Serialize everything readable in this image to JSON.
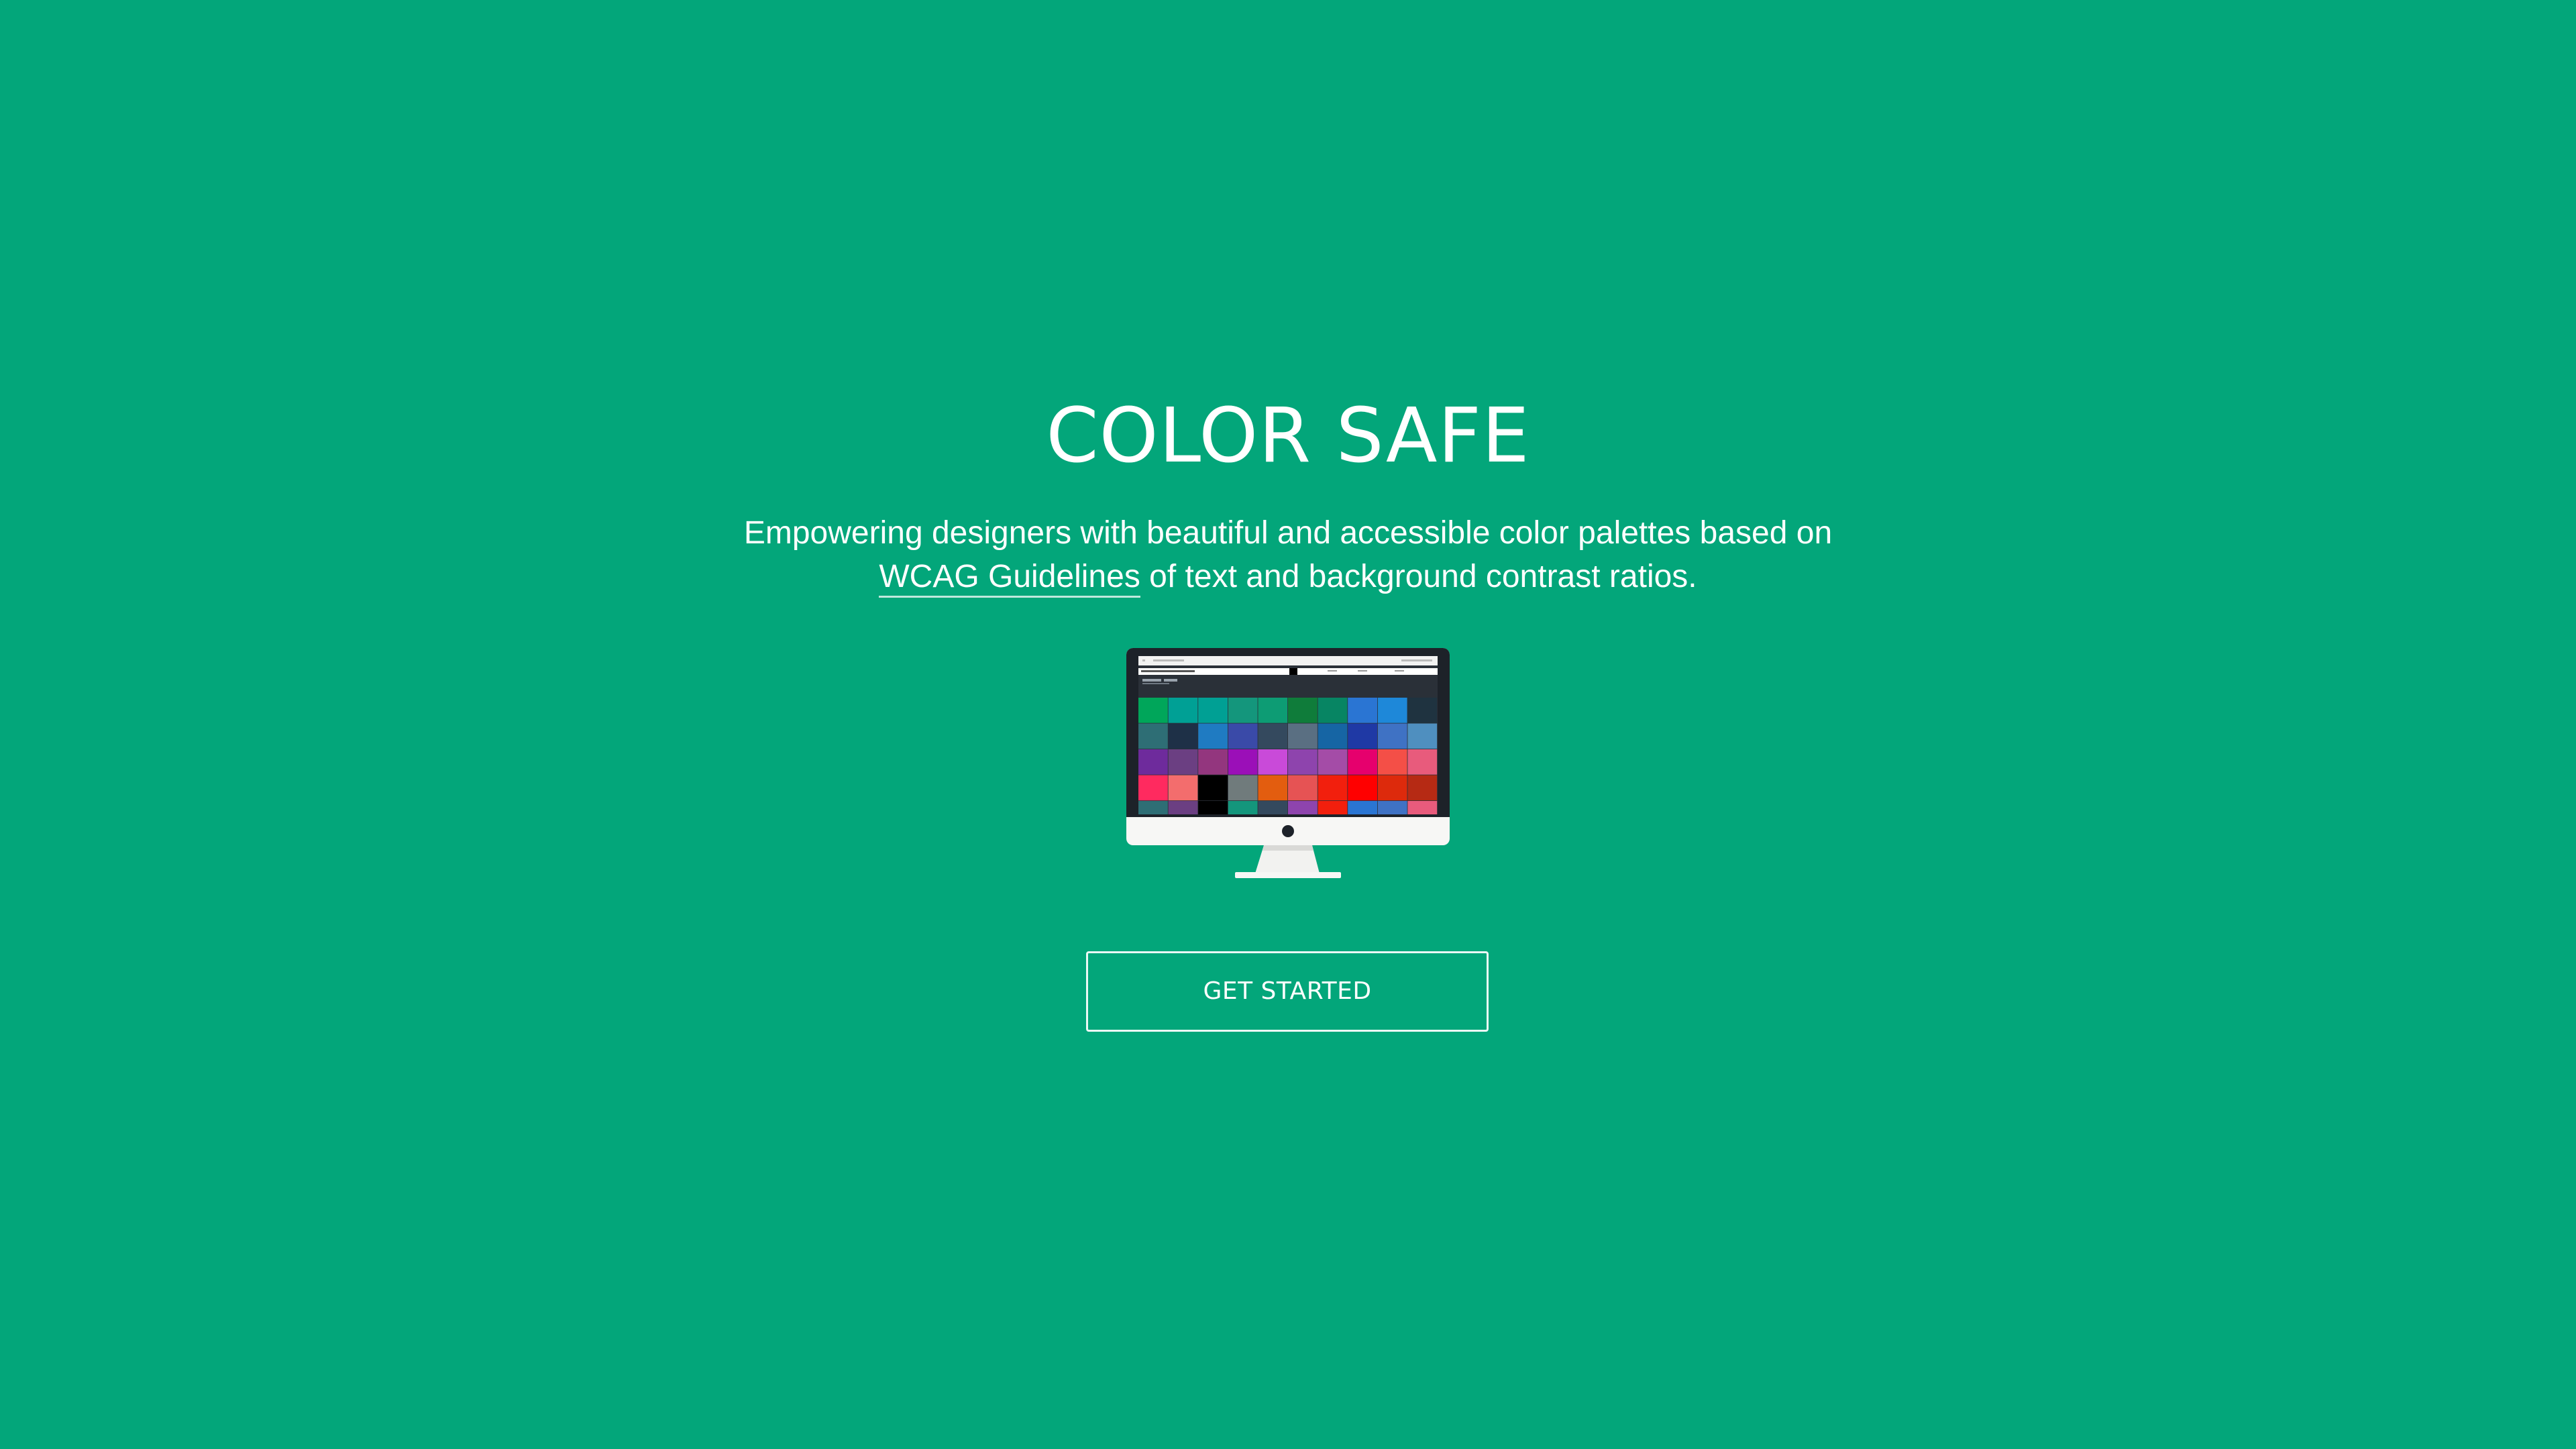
{
  "hero": {
    "title": "COLOR SAFE",
    "subtitle_line1": "Empowering designers with beautiful and accessible color palettes based on",
    "subtitle_link": "WCAG Guidelines",
    "subtitle_line2_rest": " of text and background contrast ratios.",
    "cta_label": "GET STARTED"
  },
  "colors": {
    "background": "#03a67a",
    "text": "#ffffff",
    "monitor_bezel": "#1d2229",
    "monitor_body": "#f7f7f5"
  },
  "monitor_icon": "imac-monitor-icon",
  "palette_swatches": [
    [
      "#00a65a",
      "#00a095",
      "#00a094",
      "#14967c",
      "#0d9c74",
      "#0f7c3a",
      "#078563",
      "#2a75d3",
      "#1e88d9",
      "#1f3340"
    ],
    [
      "#2e6e75",
      "#1e3047",
      "#1f7bc2",
      "#3a4aa8",
      "#34495e",
      "#5a6f82",
      "#1665a4",
      "#1f39a5",
      "#3f72c4",
      "#4f8fbf"
    ],
    [
      "#6e2b9c",
      "#6b3f82",
      "#93367e",
      "#9b0fb8",
      "#c94ad9",
      "#8e44ad",
      "#a44ca7",
      "#e6006d",
      "#f44f47",
      "#e85b7c"
    ],
    [
      "#ff2a5f",
      "#f36d6d",
      "#000000",
      "#707b7c",
      "#e35d0f",
      "#e65354",
      "#f21f0d",
      "#ff0000",
      "#dd2a0c",
      "#b62a14"
    ]
  ]
}
